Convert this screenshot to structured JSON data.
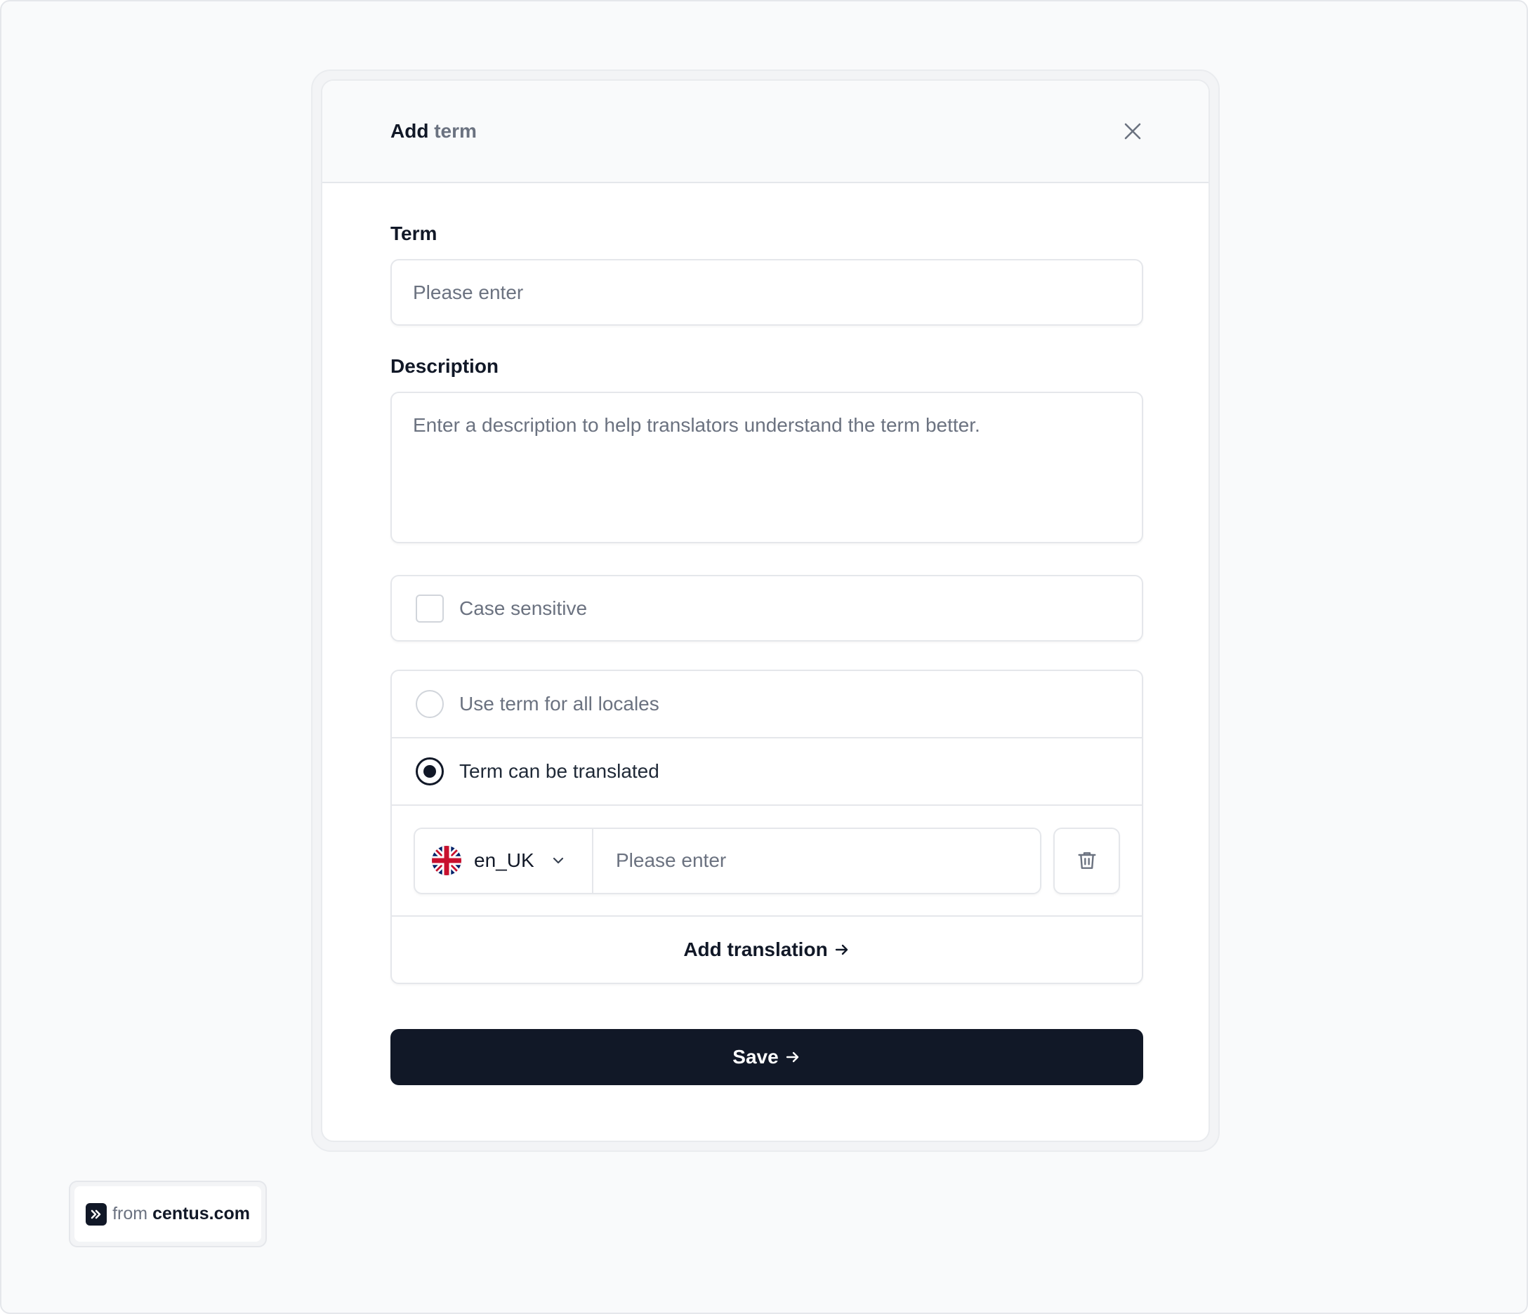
{
  "modal": {
    "title_prefix": "Add",
    "title_suffix": "term"
  },
  "form": {
    "term_label": "Term",
    "term_placeholder": "Please enter",
    "description_label": "Description",
    "description_placeholder": "Enter a description to help translators understand the term better.",
    "case_sensitive_label": "Case sensitive",
    "case_sensitive_checked": false,
    "options": [
      {
        "label": "Use term for all locales",
        "selected": false
      },
      {
        "label": "Term can be translated",
        "selected": true
      }
    ],
    "translation": {
      "locale": "en_UK",
      "flag_icon": "uk-flag-icon",
      "placeholder": "Please enter"
    },
    "add_translation_label": "Add translation",
    "save_label": "Save"
  },
  "badge": {
    "from": "from",
    "site": "centus.com"
  },
  "colors": {
    "primary": "#111827",
    "border": "#e5e7eb",
    "muted": "#6b7280"
  }
}
